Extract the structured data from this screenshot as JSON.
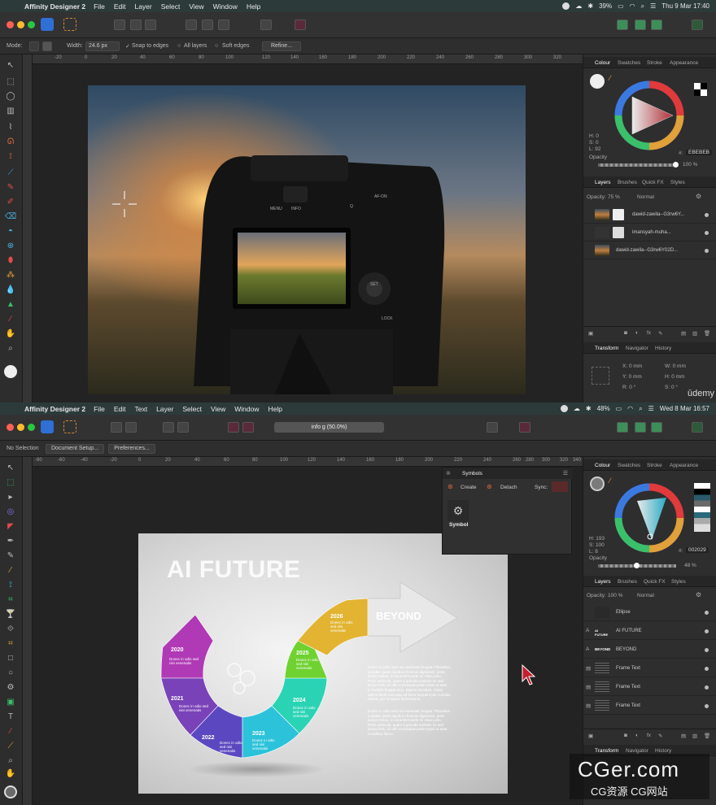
{
  "top": {
    "menubar": {
      "app_name": "Affinity Designer 2",
      "menus": [
        "File",
        "Edit",
        "Layer",
        "Select",
        "View",
        "Window",
        "Help"
      ],
      "battery": "39%",
      "clock": "Thu 9 Mar  17:40"
    },
    "context": {
      "mode_label": "Mode:",
      "width_label": "Width:",
      "width_value": "24.6 px",
      "snap_label": "Snap to edges",
      "all_layers_label": "All layers",
      "soft_edges_label": "Soft edges",
      "refine_label": "Refine..."
    },
    "ruler_ticks": [
      "-20",
      "0",
      "20",
      "40",
      "60",
      "80",
      "100",
      "120",
      "140",
      "160",
      "180",
      "200",
      "220",
      "240",
      "260",
      "280",
      "300",
      "320"
    ],
    "photo_camera_buttons": [
      "MENU",
      "INFO",
      "Q",
      "AF-ON",
      "SET",
      "LOCK"
    ],
    "color_panel": {
      "tabs": [
        "Colour",
        "Swatches",
        "Stroke",
        "Appearance"
      ],
      "h": "H: 0",
      "s": "S: 0",
      "l": "L: 92",
      "hex_label": "#:",
      "hex": "EBEBEB",
      "opacity_label": "Opacity",
      "opacity_value": "100 %",
      "wheel_hue": "#c0303a"
    },
    "layers_panel": {
      "tabs": [
        "Layers",
        "Brushes",
        "Quick FX",
        "Styles"
      ],
      "opacity_label": "Opacity:",
      "opacity_value": "75 %",
      "blend_mode": "Normal",
      "layers": [
        "dawid-zawila--G3rw6Y...",
        "imansyah-muha...",
        "dawid-zawila--G3rw6Y02D..."
      ]
    },
    "transform_panel": {
      "tabs": [
        "Transform",
        "Navigator",
        "History"
      ],
      "x": "X: 0 mm",
      "y": "Y: 0 mm",
      "w": "W: 0 mm",
      "h": "H: 0 mm",
      "r": "R: 0 °",
      "s": "S: 0 °"
    },
    "watermark": "ūdemy"
  },
  "bottom": {
    "menubar": {
      "app_name": "Affinity Designer 2",
      "menus": [
        "File",
        "Edit",
        "Text",
        "Layer",
        "Select",
        "View",
        "Window",
        "Help"
      ],
      "battery": "48%",
      "clock": "Wed 8 Mar  16:57"
    },
    "document_tab": "info g (50.0%)",
    "context": {
      "selection": "No Selection",
      "doc_setup": "Document Setup...",
      "preferences": "Preferences..."
    },
    "ruler_ticks": [
      "-80",
      "-60",
      "-40",
      "-20",
      "0",
      "20",
      "40",
      "60",
      "80",
      "100",
      "120",
      "140",
      "160",
      "180",
      "200",
      "220",
      "240",
      "260",
      "280",
      "300",
      "320",
      "340"
    ],
    "symbols_panel": {
      "title": "Symbols",
      "create": "Create",
      "detach": "Detach",
      "sync": "Sync:",
      "symbol_label": "Symbol"
    },
    "infographic": {
      "title": "AI FUTURE",
      "beyond": "BEYOND",
      "years": [
        "2020",
        "2021",
        "2022",
        "2023",
        "2024",
        "2025",
        "2026"
      ],
      "segment_text": "Donec in odio sed nisi venenatis",
      "segment_colors": [
        "#b039b5",
        "#7a42b8",
        "#5b48c0",
        "#2cc2da",
        "#2ad3b4",
        "#6fd231",
        "#e2b431"
      ],
      "para1": "Donec in odio sed nisi venenatis feugiat. Phasellus sodales, pede dapibus rhoncus dignissim, justo luctus metus, in imperdiet pede mi vitae justo. Proin vehicula, quam a gravida sodales mi sed luctus felis, id nibh consequat pede turpis ut ante. In facilisis feugiat arcu. Mauris tincidunt. Class aptent taciti sociosqu ad litora torquent per conubia nostra, per inceptos hymenaeos.",
      "para2": "Donec in odio sed nisi venenatis feugiat. Phasellus sodales, pede dapibus rhoncus dignissim, justo luctus metus, in imperdiet pede mi vitae justo. Proin vehicula, quam a gravida sodales mi sed luctus felis, id nibh consequat pede turpis ut ante. Curabitur libero."
    },
    "color_panel": {
      "tabs": [
        "Colour",
        "Swatches",
        "Stroke",
        "Appearance"
      ],
      "h": "H: 193",
      "s": "S: 100",
      "l": "L: 8",
      "hex_label": "#:",
      "hex": "002029",
      "opacity_label": "Opacity",
      "opacity_value": "48 %",
      "wheel_hue": "#2ab8d6"
    },
    "layers_panel": {
      "tabs": [
        "Layers",
        "Brushes",
        "Quick FX",
        "Styles"
      ],
      "opacity_label": "Opacity:",
      "opacity_value": "100 %",
      "blend_mode": "Normal",
      "layers": [
        {
          "name": "Ellipse",
          "thumb": ""
        },
        {
          "name": "AI FUTURE",
          "thumb": "AI FUTURE"
        },
        {
          "name": "BEYOND",
          "thumb": "BEYOND"
        },
        {
          "name": "Frame Text",
          "thumb": ""
        },
        {
          "name": "Frame Text",
          "thumb": ""
        },
        {
          "name": "Frame Text",
          "thumb": ""
        }
      ]
    },
    "transform_panel": {
      "tabs": [
        "Transform",
        "Navigator",
        "History"
      ]
    },
    "watermark_main": "CGer.com",
    "watermark_sub": "CG资源  CG网站"
  }
}
